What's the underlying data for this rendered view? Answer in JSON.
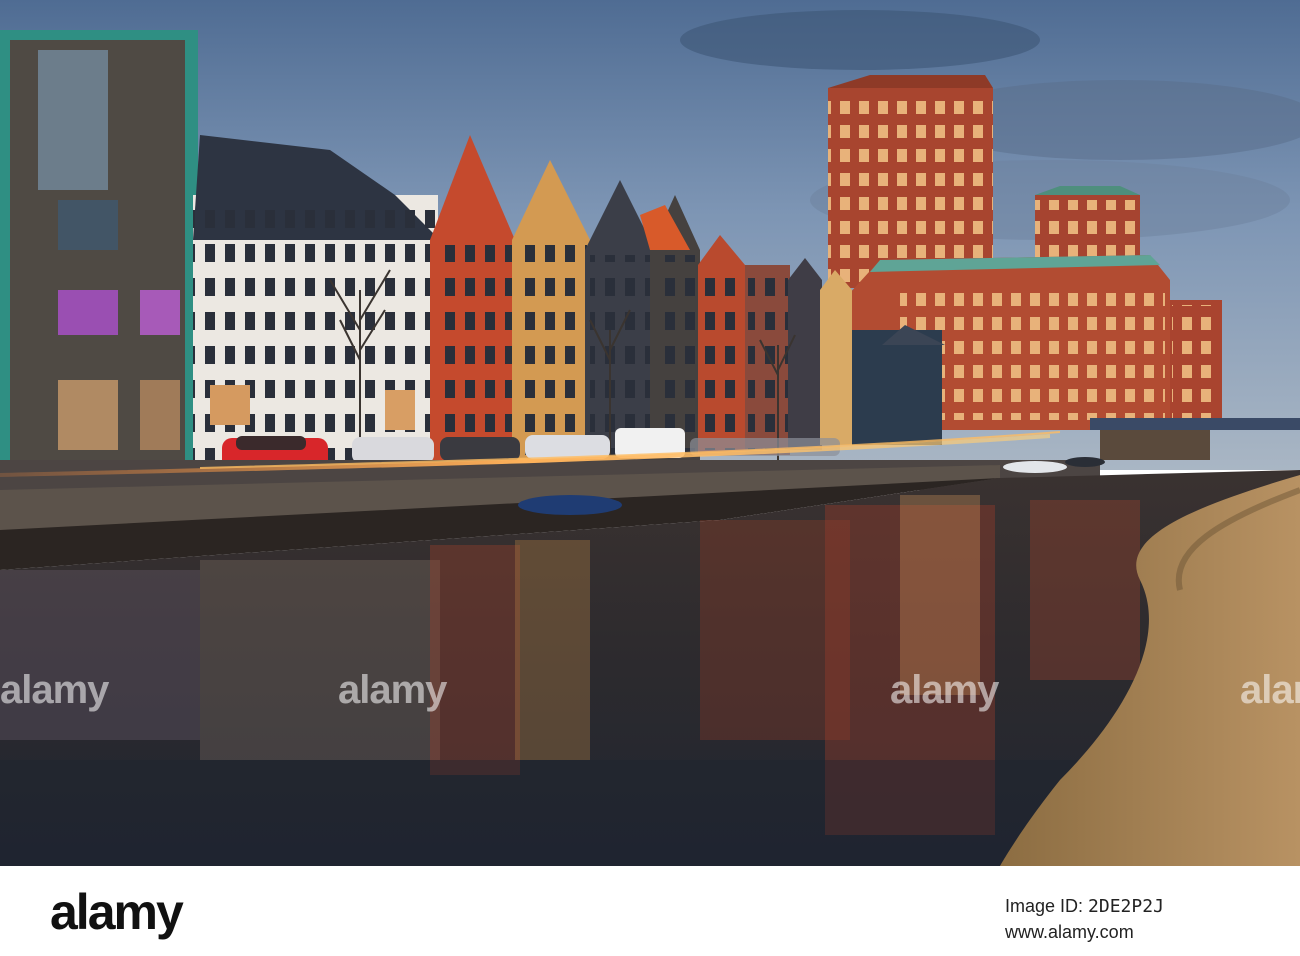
{
  "watermark": {
    "text": "alamy"
  },
  "footer": {
    "brand": "alamy",
    "image_id_label": "Image ID:",
    "image_id": "2DE2P2J",
    "site": "www.alamy.com"
  }
}
